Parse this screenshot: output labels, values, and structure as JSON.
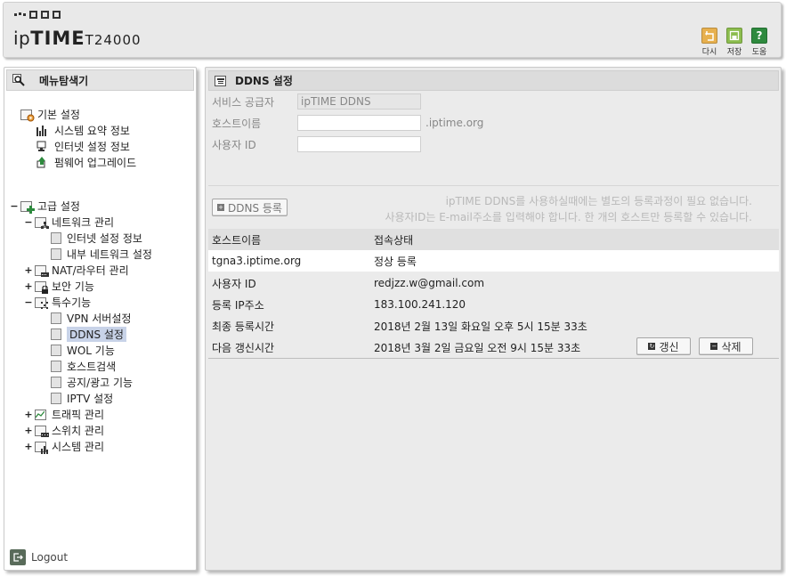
{
  "header": {
    "brand": "ipTIME",
    "model": "T24000",
    "buttons": [
      {
        "label": "다시",
        "icon": "undo-icon",
        "color": "#e7b04e"
      },
      {
        "label": "저장",
        "icon": "save-icon",
        "color": "#8cbd4e"
      },
      {
        "label": "도움",
        "icon": "help-icon",
        "color": "#2e8a3e",
        "glyph": "?"
      }
    ]
  },
  "sidebar": {
    "title": "메뉴탐색기",
    "basic": {
      "label": "기본 설정",
      "items": [
        "시스템 요약 정보",
        "인터넷 설정 정보",
        "펌웨어 업그레이드"
      ]
    },
    "advanced": {
      "label": "고급 설정",
      "network": {
        "label": "네트워크 관리",
        "items": [
          "인터넷 설정 정보",
          "내부 네트워크 설정"
        ]
      },
      "nat": "NAT/라우터 관리",
      "security": "보안 기능",
      "special": {
        "label": "특수기능",
        "items": [
          "VPN 서버설정",
          "DDNS 설정",
          "WOL 기능",
          "호스트검색",
          "공지/광고 기능",
          "IPTV 설정"
        ]
      },
      "traffic": "트래픽 관리",
      "switch": "스위치 관리",
      "system": "시스템 관리"
    },
    "logout": "Logout",
    "toggles": {
      "expanded": "−",
      "collapsed": "+"
    }
  },
  "main": {
    "title": "DDNS 설정",
    "form": {
      "provider_label": "서비스 공급자",
      "provider_value": "ipTIME DDNS",
      "hostname_label": "호스트이름",
      "hostname_value": "",
      "hostname_suffix": ".iptime.org",
      "userid_label": "사용자 ID",
      "userid_value": ""
    },
    "register_button": "DDNS 등록",
    "notice_line1": "ipTIME DDNS를 사용하실때에는 별도의 등록과정이 필요 없습니다.",
    "notice_line2": "사용자ID는 E-mail주소를 입력해야 합니다. 한 개의 호스트만 등록할 수 있습니다.",
    "table": {
      "col_host": "호스트이름",
      "col_status": "접속상태",
      "host": "tgna3.iptime.org",
      "status": "정상 등록"
    },
    "details": [
      {
        "label": "사용자 ID",
        "value": "redjzz.w@gmail.com"
      },
      {
        "label": "등록 IP주소",
        "value": "183.100.241.120"
      },
      {
        "label": "최종 등록시간",
        "value": "2018년 2월 13일 화요일 오후 5시 15분 33초"
      },
      {
        "label": "다음 갱신시간",
        "value": "2018년 3월 2일 금요일 오전 9시 15분 33초"
      }
    ],
    "refresh_button": "갱신",
    "delete_button": "삭제"
  }
}
